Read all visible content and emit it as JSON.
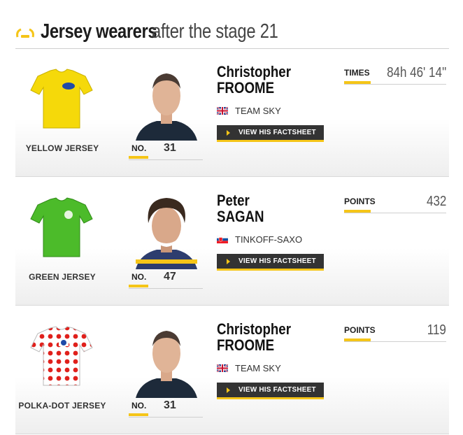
{
  "header": {
    "title_strong": "Jersey wearers",
    "title_light": "after the stage 21"
  },
  "colors": {
    "accent": "#f5c518",
    "yellow_jersey": "#f5d90a",
    "green_jersey": "#4cbb2a",
    "polka_dot": "#e0201b"
  },
  "rows": [
    {
      "jersey_icon": "yellow-jersey-icon",
      "jersey_label": "YELLOW JERSEY",
      "rider_first": "Christopher",
      "rider_last": "FROOME",
      "team_flag": "uk-flag-icon",
      "team": "TEAM SKY",
      "factsheet_label": "VIEW HIS FACTSHEET",
      "no_label": "NO.",
      "no_value": "31",
      "stat_label": "TIMES",
      "stat_value": "84h 46' 14''"
    },
    {
      "jersey_icon": "green-jersey-icon",
      "jersey_label": "GREEN JERSEY",
      "rider_first": "Peter",
      "rider_last": "SAGAN",
      "team_flag": "slovakia-flag-icon",
      "team": "TINKOFF-SAXO",
      "factsheet_label": "VIEW HIS FACTSHEET",
      "no_label": "NO.",
      "no_value": "47",
      "stat_label": "POINTS",
      "stat_value": "432"
    },
    {
      "jersey_icon": "polka-dot-jersey-icon",
      "jersey_label": "POLKA-DOT JERSEY",
      "rider_first": "Christopher",
      "rider_last": "FROOME",
      "team_flag": "uk-flag-icon",
      "team": "TEAM SKY",
      "factsheet_label": "VIEW HIS FACTSHEET",
      "no_label": "NO.",
      "no_value": "31",
      "stat_label": "POINTS",
      "stat_value": "119"
    }
  ]
}
